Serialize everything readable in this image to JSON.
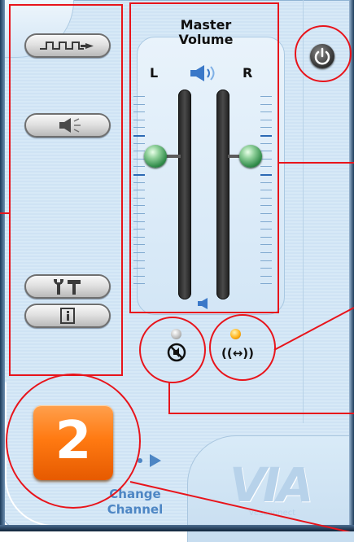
{
  "window": {
    "brand_text": "VIA",
    "brand_subtext": "vesconnect"
  },
  "left_buttons": [
    {
      "id": "speaker-test",
      "icon": "pulse-signal-icon"
    },
    {
      "id": "speaker-config",
      "icon": "speaker-sound-icon"
    },
    {
      "id": "tools",
      "icon": "tools-icon"
    },
    {
      "id": "info",
      "icon": "info-icon"
    }
  ],
  "volume": {
    "title_line1": "Master",
    "title_line2": "Volume",
    "left_label": "L",
    "right_label": "R",
    "left_level_percent": 65,
    "right_level_percent": 65,
    "mute_indicator_icon": "speaker-icon",
    "min_indicator_icon": "speaker-low-icon"
  },
  "toggles": {
    "mute": {
      "icon": "mute-icon",
      "led": "off"
    },
    "stereo_expand": {
      "icon": "stereo-widen-icon",
      "text": "((↔))",
      "led": "on"
    }
  },
  "channel": {
    "number": "2",
    "label_line1": "Change",
    "label_line2": "Channel"
  },
  "colors": {
    "annotation_red": "#e8141b",
    "badge_orange": "#ff7a12",
    "channel_label_blue": "#4d86c4",
    "led_on": "#ffb31a"
  }
}
